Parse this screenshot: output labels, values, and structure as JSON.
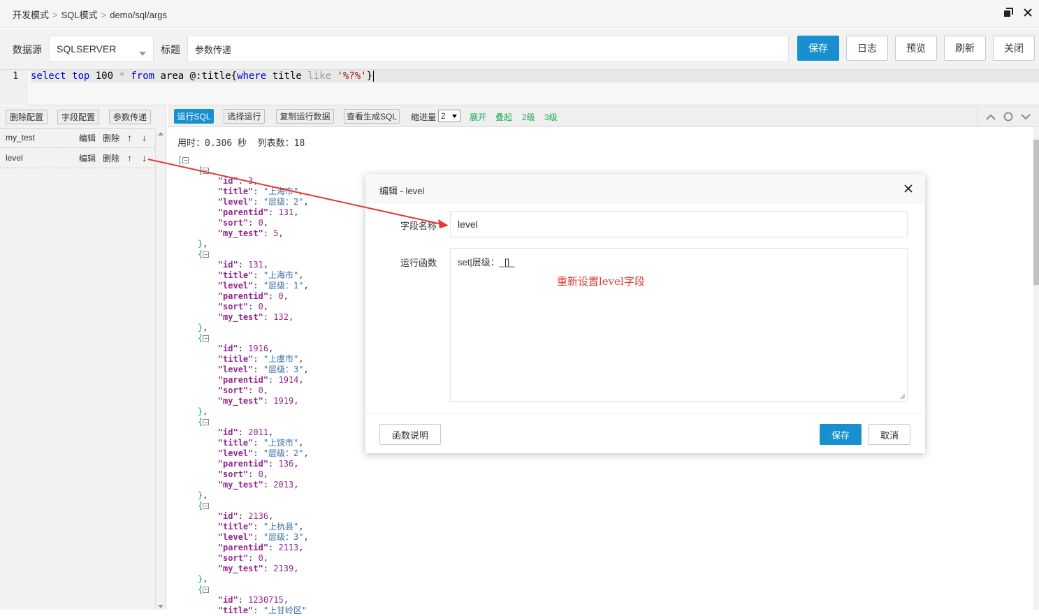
{
  "breadcrumb": {
    "items": [
      "开发模式",
      "SQL模式",
      "demo/sql/args"
    ],
    "separator": ">"
  },
  "toolbar": {
    "datasource_label": "数据源",
    "datasource_value": "SQLSERVER",
    "title_label": "标题",
    "title_value": "参数传递",
    "buttons": {
      "save": "保存",
      "log": "日志",
      "preview": "预览",
      "refresh": "刷新",
      "close": "关闭"
    }
  },
  "editor": {
    "line_number": "1",
    "tokens": [
      "select",
      "top",
      "100",
      "*",
      "from",
      "area",
      "@:title{",
      "where",
      "title",
      "like",
      "'%?%'",
      "}"
    ]
  },
  "left_panel": {
    "buttons": {
      "delete_config": "删除配置",
      "field_config": "字段配置",
      "param_pass": "参数传递"
    },
    "rows": [
      {
        "name": "my_test",
        "edit": "编辑",
        "delete": "删除",
        "up": "↑",
        "down": "↓"
      },
      {
        "name": "level",
        "edit": "编辑",
        "delete": "删除",
        "up": "↑",
        "down": "↓"
      }
    ]
  },
  "results_toolbar": {
    "run_sql": "运行SQL",
    "select_run": "选择运行",
    "copy_data": "复制运行数据",
    "view_sql": "查看生成SQL",
    "indent_label": "缩进量",
    "indent_value": "2",
    "expand": "展开",
    "collapse": "叠起",
    "level2": "2级",
    "level3": "3级"
  },
  "result_info": {
    "time_label": "用时：",
    "time_value": "0.306 秒",
    "cols_label": "列表数：",
    "cols_value": "18"
  },
  "json_records": [
    {
      "id": "3",
      "title": "\"上海市\"",
      "level": "\"层级：2\"",
      "parentid": "131",
      "sort": "0",
      "my_test": "5"
    },
    {
      "id": "131",
      "title": "\"上海市\"",
      "level": "\"层级：1\"",
      "parentid": "0",
      "sort": "0",
      "my_test": "132"
    },
    {
      "id": "1916",
      "title": "\"上虞市\"",
      "level": "\"层级：3\"",
      "parentid": "1914",
      "sort": "0",
      "my_test": "1919"
    },
    {
      "id": "2011",
      "title": "\"上饶市\"",
      "level": "\"层级：2\"",
      "parentid": "136",
      "sort": "0",
      "my_test": "2013"
    },
    {
      "id": "2136",
      "title": "\"上杭县\"",
      "level": "\"层级：3\"",
      "parentid": "2113",
      "sort": "0",
      "my_test": "2139"
    },
    {
      "id": "1230715",
      "title": "\"上甘岭区\""
    }
  ],
  "modal": {
    "title": "编辑 - level",
    "field_name_label": "字段名称",
    "field_name_value": "level",
    "func_label": "运行函数",
    "func_value": "set|层级：_[]_",
    "annotation": "重新设置level字段",
    "help_button": "函数说明",
    "save_button": "保存",
    "cancel_button": "取消"
  },
  "colors": {
    "primary": "#1890d0",
    "annotation": "#e53935",
    "green": "#1aaa55"
  }
}
